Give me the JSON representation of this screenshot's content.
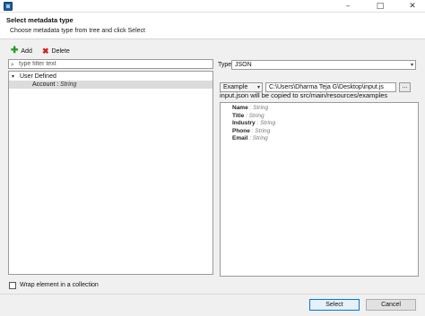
{
  "window": {
    "minimize": "–",
    "maximize": "□",
    "close": "✕"
  },
  "header": {
    "title": "Select metadata type",
    "subtitle": "Choose metadata type from tree and click Select"
  },
  "toolbar": {
    "add_label": "Add",
    "delete_label": "Delete"
  },
  "filter": {
    "placeholder": "type filter text",
    "value": ""
  },
  "tree": {
    "root": {
      "label": "User Defined",
      "expanded": true
    },
    "child": {
      "name": "Account",
      "type_sep": " : ",
      "type": "String",
      "selected": true
    }
  },
  "type": {
    "label": "Type",
    "value": "JSON"
  },
  "example": {
    "mode": "Example",
    "path": "C:\\Users\\Dharma Teja G\\Desktop\\input.js",
    "browse": "...",
    "note": "input.json will be copied to src/main/resources/examples"
  },
  "fields": [
    {
      "name": "Name",
      "sep": " : ",
      "type": "String"
    },
    {
      "name": "Title",
      "sep": " : ",
      "type": "String"
    },
    {
      "name": "Industry",
      "sep": " : ",
      "type": "String"
    },
    {
      "name": "Phone",
      "sep": " : ",
      "type": "String"
    },
    {
      "name": "Email",
      "sep": " : ",
      "type": "String"
    }
  ],
  "wrap": {
    "label": "Wrap element in a collection",
    "checked": false
  },
  "buttons": {
    "select": "Select",
    "cancel": "Cancel"
  },
  "colors": {
    "accent": "#0078d7",
    "selection": "#dcdcdc",
    "add": "#2a9a2a",
    "delete": "#d02020"
  }
}
